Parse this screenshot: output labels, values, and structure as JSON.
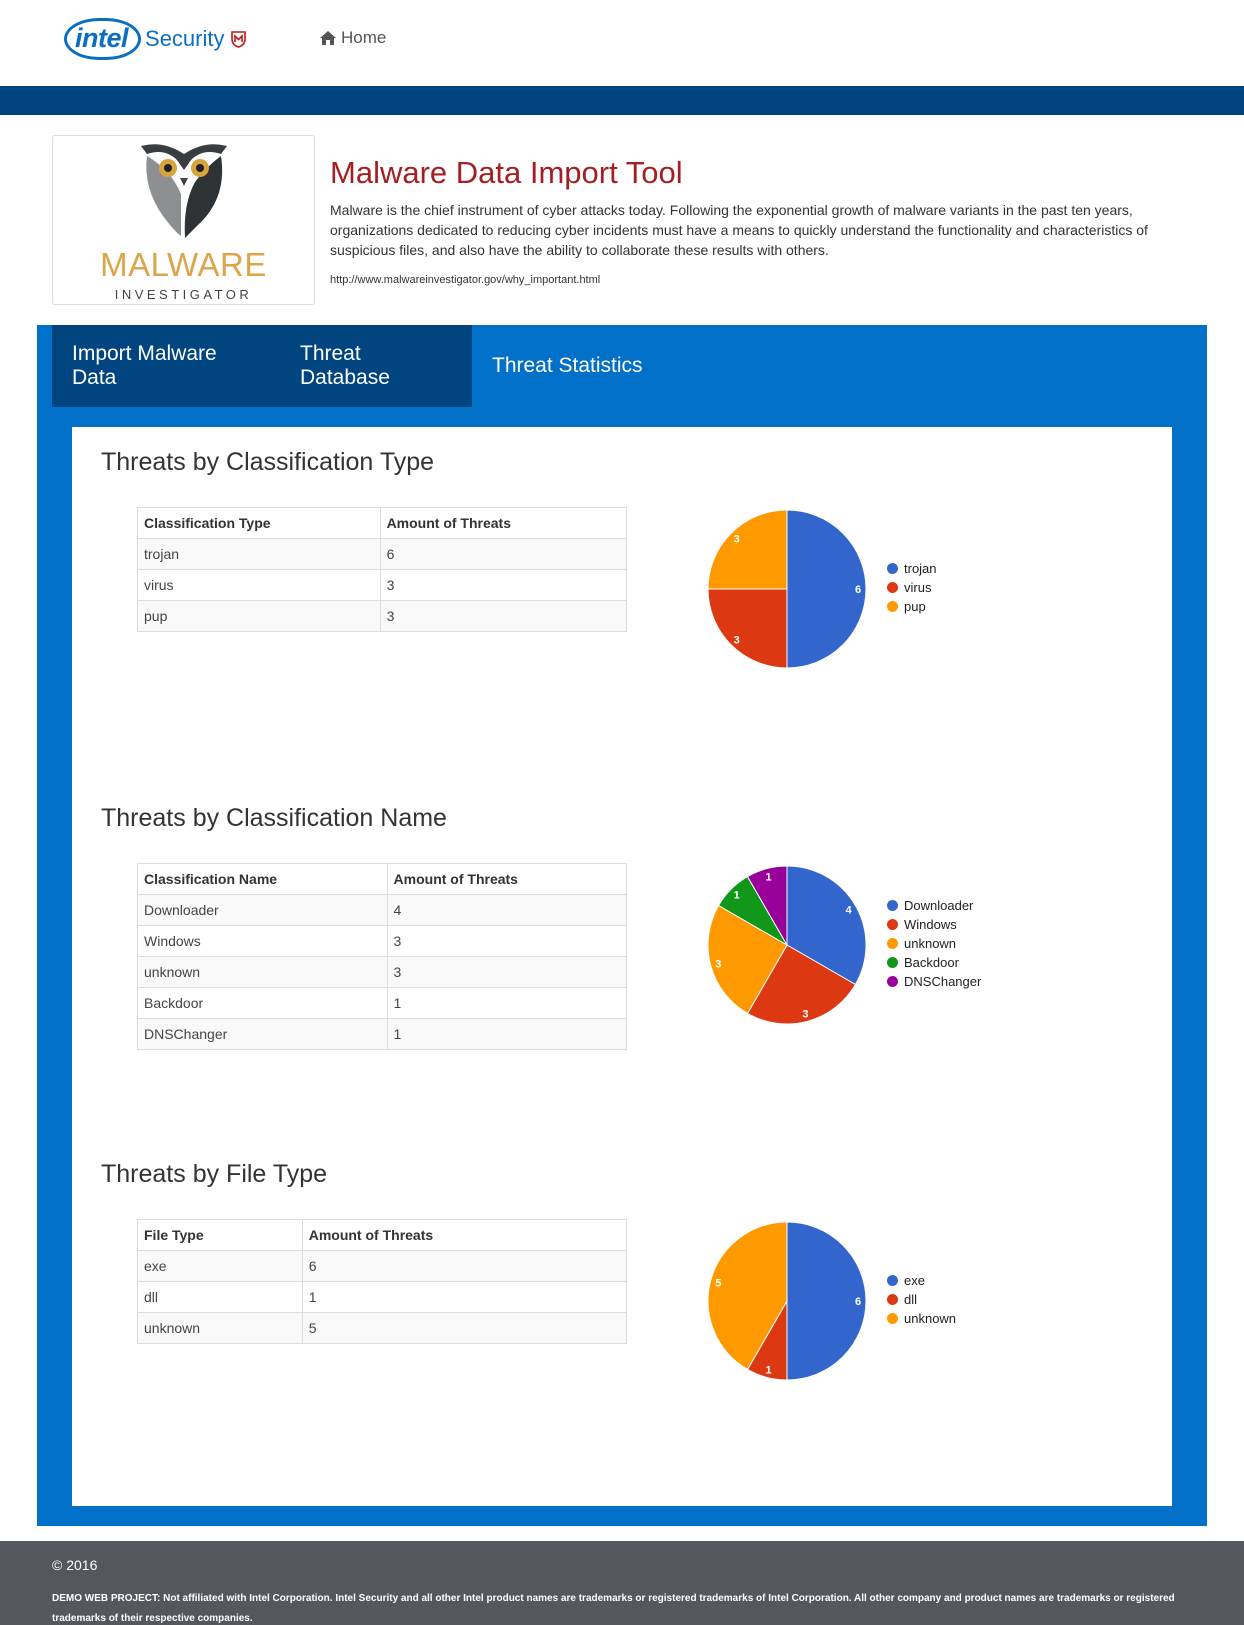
{
  "header": {
    "brand": {
      "intel": "intel",
      "security": "Security"
    },
    "nav_home": "Home"
  },
  "logo": {
    "word": "MALWARE",
    "sub": "INVESTIGATOR"
  },
  "intro": {
    "title": "Malware Data Import Tool",
    "description": "Malware is the chief instrument of cyber attacks today. Following the exponential growth of malware variants in the past ten years, organizations dedicated to reducing cyber incidents must have a means to quickly understand the functionality and characteristics of suspicious files, and also have the ability to collaborate these results with others.",
    "link": "http://www.malwareinvestigator.gov/why_important.html"
  },
  "tabs": [
    {
      "label": "Import Malware Data"
    },
    {
      "label": "Threat Database"
    },
    {
      "label": "Threat Statistics"
    }
  ],
  "sections": [
    {
      "title": "Threats by Classification Type",
      "columns": [
        "Classification Type",
        "Amount of Threats"
      ],
      "rows": [
        [
          "trojan",
          "6"
        ],
        [
          "virus",
          "3"
        ],
        [
          "pup",
          "3"
        ]
      ]
    },
    {
      "title": "Threats by Classification Name",
      "columns": [
        "Classification Name",
        "Amount of Threats"
      ],
      "rows": [
        [
          "Downloader",
          "4"
        ],
        [
          "Windows",
          "3"
        ],
        [
          "unknown",
          "3"
        ],
        [
          "Backdoor",
          "1"
        ],
        [
          "DNSChanger",
          "1"
        ]
      ]
    },
    {
      "title": "Threats by File Type",
      "columns": [
        "File Type",
        "Amount of Threats"
      ],
      "rows": [
        [
          "exe",
          "6"
        ],
        [
          "dll",
          "1"
        ],
        [
          "unknown",
          "5"
        ]
      ]
    }
  ],
  "chart_data": [
    {
      "type": "pie",
      "categories": [
        "trojan",
        "virus",
        "pup"
      ],
      "values": [
        6,
        3,
        3
      ],
      "colors": [
        "#3366cc",
        "#dc3912",
        "#ff9900"
      ],
      "legend": "right"
    },
    {
      "type": "pie",
      "categories": [
        "Downloader",
        "Windows",
        "unknown",
        "Backdoor",
        "DNSChanger"
      ],
      "values": [
        4,
        3,
        3,
        1,
        1
      ],
      "colors": [
        "#3366cc",
        "#dc3912",
        "#ff9900",
        "#109618",
        "#990099"
      ],
      "legend": "right"
    },
    {
      "type": "pie",
      "categories": [
        "exe",
        "dll",
        "unknown"
      ],
      "values": [
        6,
        1,
        5
      ],
      "colors": [
        "#3366cc",
        "#dc3912",
        "#ff9900"
      ],
      "legend": "right"
    }
  ],
  "footer": {
    "copyright": "© 2016",
    "disclaimer": "DEMO WEB PROJECT: Not affiliated with Intel Corporation. Intel Security and all other Intel product names are trademarks or registered trademarks of Intel Corporation. All other company and product names are trademarks or registered trademarks of their respective companies."
  },
  "colors": {
    "brand_blue": "#0a6fc2",
    "band": "#00457f",
    "panel": "#0170c9",
    "title_red": "#a41f23",
    "footer": "#54575c"
  }
}
